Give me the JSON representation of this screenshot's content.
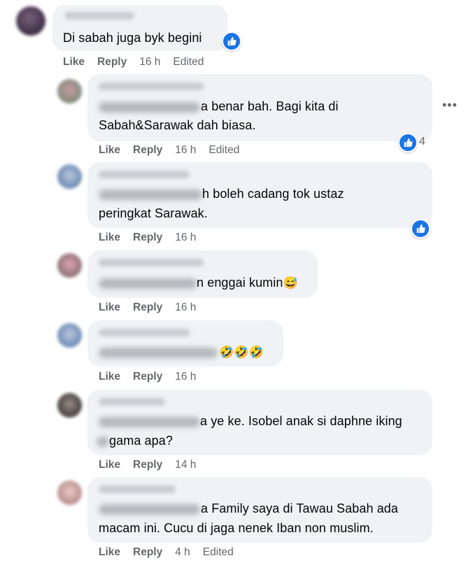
{
  "comments": [
    {
      "text": "Di sabah juga byk begini",
      "actions": {
        "like": "Like",
        "reply": "Reply",
        "time": "16 h",
        "edited": "Edited"
      }
    },
    {
      "text_line1": "a benar bah. Bagi kita di",
      "text_line2": "Sabah&Sarawak dah biasa.",
      "reaction_count": "4",
      "actions": {
        "like": "Like",
        "reply": "Reply",
        "time": "16 h",
        "edited": "Edited"
      }
    },
    {
      "text_line1": "h boleh cadang tok ustaz",
      "text_line2": "peringkat Sarawak.",
      "actions": {
        "like": "Like",
        "reply": "Reply",
        "time": "16 h"
      }
    },
    {
      "text": "n enggai kumin",
      "emoji": "😅",
      "actions": {
        "like": "Like",
        "reply": "Reply",
        "time": "16 h"
      }
    },
    {
      "emoji": "🤣🤣🤣",
      "actions": {
        "like": "Like",
        "reply": "Reply",
        "time": "16 h"
      }
    },
    {
      "text_line1": "a ye ke. Isobel anak si daphne iking",
      "text_line2": "gama apa?",
      "actions": {
        "like": "Like",
        "reply": "Reply",
        "time": "14 h"
      }
    },
    {
      "text_line1": "a Family saya di Tawau Sabah ada",
      "text_line2": "macam ini. Cucu di jaga nenek Iban non muslim.",
      "actions": {
        "like": "Like",
        "reply": "Reply",
        "time": "4 h",
        "edited": "Edited"
      }
    }
  ],
  "icons": {
    "like_reaction": "thumbs-up-icon",
    "more": "more-options-icon"
  },
  "colors": {
    "bubble": "#f0f2f5",
    "like_blue": "#1b74e4",
    "meta_gray": "#65676b"
  }
}
